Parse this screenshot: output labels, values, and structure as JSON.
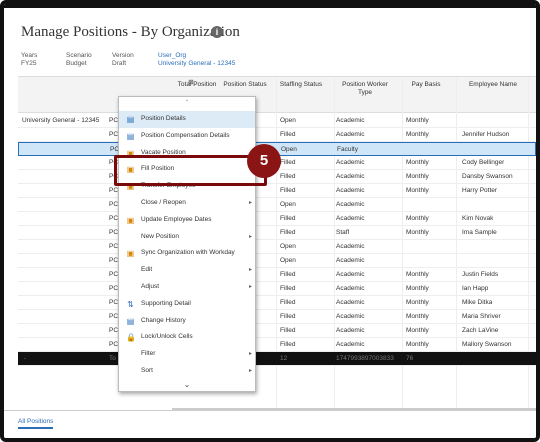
{
  "page": {
    "title": "Manage Positions - By Organization"
  },
  "pov": [
    {
      "label": "Years",
      "value": "FY25"
    },
    {
      "label": "Scenario",
      "value": "Budget"
    },
    {
      "label": "Version",
      "value": "Draft"
    },
    {
      "label": "User_Org",
      "value": "University General - 12345"
    }
  ],
  "columns": [
    "Total Position",
    "Position Status",
    "Staffing Status",
    "Position Worker Type",
    "Pay Basis",
    "Employee Name"
  ],
  "org_label": "University General - 12345",
  "row_prefix": "PC",
  "rows": [
    {
      "staffing": "Open",
      "type": "Academic",
      "pay": "Monthly",
      "name": ""
    },
    {
      "staffing": "Filled",
      "type": "Academic",
      "pay": "Monthly",
      "name": "Jennifer Hudson"
    },
    {
      "staffing": "Open",
      "type": "Faculty",
      "pay": "",
      "name": ""
    },
    {
      "staffing": "Filled",
      "type": "Academic",
      "pay": "Monthly",
      "name": "Cody Bellinger"
    },
    {
      "staffing": "Filled",
      "type": "Academic",
      "pay": "Monthly",
      "name": "Dansby Swanson"
    },
    {
      "staffing": "Filled",
      "type": "Academic",
      "pay": "Monthly",
      "name": "Harry Potter"
    },
    {
      "staffing": "Open",
      "type": "Academic",
      "pay": "",
      "name": ""
    },
    {
      "staffing": "Filled",
      "type": "Academic",
      "pay": "Monthly",
      "name": "Kim Novak"
    },
    {
      "staffing": "Filled",
      "type": "Staff",
      "pay": "Monthly",
      "name": "Ima Sample"
    },
    {
      "staffing": "Open",
      "type": "Academic",
      "pay": "",
      "name": ""
    },
    {
      "staffing": "Open",
      "type": "Academic",
      "pay": "",
      "name": ""
    },
    {
      "staffing": "Filled",
      "type": "Academic",
      "pay": "Monthly",
      "name": "Justin Fields"
    },
    {
      "staffing": "Filled",
      "type": "Academic",
      "pay": "Monthly",
      "name": "Ian Happ"
    },
    {
      "staffing": "Filled",
      "type": "Academic",
      "pay": "Monthly",
      "name": "Mike Ditka"
    },
    {
      "staffing": "Filled",
      "type": "Academic",
      "pay": "Monthly",
      "name": "Maria Shriver"
    },
    {
      "staffing": "Filled",
      "type": "Academic",
      "pay": "Monthly",
      "name": "Zach LaVine"
    },
    {
      "staffing": "Filled",
      "type": "Academic",
      "pay": "Monthly",
      "name": "Mallory Swanson"
    }
  ],
  "total_row": {
    "dash": "-",
    "label": "To",
    "v1": "12",
    "v2": "1747993897003833",
    "v3": "76"
  },
  "menu": [
    {
      "label": "Position Details",
      "icon": "document-icon",
      "glyph": "▤",
      "color": "blue",
      "arrow": false
    },
    {
      "label": "Position Compensation Details",
      "icon": "document-icon",
      "glyph": "▤",
      "color": "blue",
      "arrow": false
    },
    {
      "label": "Vacate Position",
      "icon": "vacate-icon",
      "glyph": "▣",
      "color": "orange",
      "arrow": false
    },
    {
      "label": "Fill Position",
      "icon": "fill-icon",
      "glyph": "▣",
      "color": "orange",
      "arrow": false
    },
    {
      "label": "Transfer Employee",
      "icon": "transfer-icon",
      "glyph": "▣",
      "color": "orange",
      "arrow": false
    },
    {
      "label": "Close / Reopen",
      "icon": "",
      "glyph": "",
      "color": "dark",
      "arrow": true
    },
    {
      "label": "Update Employee Dates",
      "icon": "calendar-icon",
      "glyph": "▣",
      "color": "orange",
      "arrow": false
    },
    {
      "label": "New Position",
      "icon": "",
      "glyph": "",
      "color": "dark",
      "arrow": true
    },
    {
      "label": "Sync Organization with Workday",
      "icon": "sync-icon",
      "glyph": "▣",
      "color": "orange",
      "arrow": false
    },
    {
      "label": "Edit",
      "icon": "",
      "glyph": "",
      "color": "dark",
      "arrow": true
    },
    {
      "label": "Adjust",
      "icon": "",
      "glyph": "",
      "color": "dark",
      "arrow": true
    },
    {
      "label": "Supporting Detail",
      "icon": "supporting-detail-icon",
      "glyph": "⇅",
      "color": "blue",
      "arrow": false
    },
    {
      "label": "Change History",
      "icon": "history-icon",
      "glyph": "▤",
      "color": "blue",
      "arrow": false
    },
    {
      "label": "Lock/Unlock Cells",
      "icon": "lock-icon",
      "glyph": "🔒",
      "color": "orange",
      "arrow": false
    },
    {
      "label": "Filter",
      "icon": "",
      "glyph": "",
      "color": "dark",
      "arrow": true
    },
    {
      "label": "Sort",
      "icon": "",
      "glyph": "",
      "color": "dark",
      "arrow": true
    }
  ],
  "callout_number": "5",
  "footer_tab": "All Positions",
  "colors": {
    "accent": "#2a6ebb",
    "callout": "#8b1414",
    "selected_row": "#cfe6f8"
  }
}
